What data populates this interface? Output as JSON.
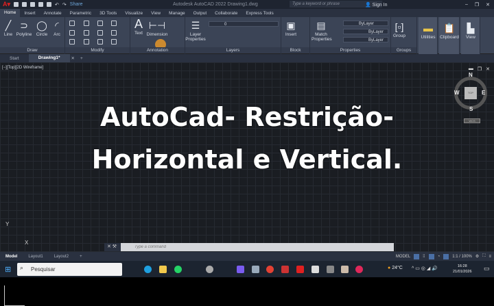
{
  "title_bar": {
    "app_title": "Autodesk AutoCAD 2022   Drawing1.dwg",
    "share": "Share",
    "search_placeholder": "Type a keyword or phrase",
    "sign_in": "Sign In"
  },
  "ribbon_tabs": [
    "Home",
    "Insert",
    "Annotate",
    "Parametric",
    "3D Tools",
    "Visualize",
    "View",
    "Manage",
    "Output",
    "Collaborate",
    "Express Tools"
  ],
  "draw_tools": [
    "Line",
    "Polyline",
    "Circle",
    "Arc"
  ],
  "panels": {
    "draw": "Draw",
    "modify": "Modify",
    "annotation": "Annotation",
    "layers": "Layers",
    "block": "Block",
    "properties": "Properties",
    "groups": "Groups"
  },
  "annotation_tools": [
    "Text",
    "Dimension"
  ],
  "layer_tools": {
    "layer_properties": "Layer Properties",
    "current_layer": "0"
  },
  "block_tools": {
    "insert": "Insert"
  },
  "properties_tools": {
    "match": "Match Properties",
    "color": "ByLayer",
    "linetype": "ByLayer",
    "lineweight": "ByLayer"
  },
  "groups_tools": {
    "group": "Group"
  },
  "big_buttons": [
    "Utilities",
    "Clipboard",
    "View"
  ],
  "file_tabs": [
    "Start",
    "Drawing1*"
  ],
  "viewport": {
    "label": "[−][Top][2D Wireframe]",
    "headline_1": "AutoCad- Restrição-",
    "headline_2": "Horizontal e Vertical.",
    "compass": {
      "n": "N",
      "s": "S",
      "e": "E",
      "w": "W",
      "top": "TOP",
      "wcs": "WCS"
    },
    "ucs_y": "Y",
    "ucs_x": "X"
  },
  "command_line": {
    "placeholder": "Type a command"
  },
  "layout_tabs": [
    "Model",
    "Layout1",
    "Layout2"
  ],
  "status_bar": {
    "model": "MODEL",
    "scale": "1:1 / 100%"
  },
  "taskbar": {
    "search": "Pesquisar",
    "weather": "24°C",
    "time": "16:28",
    "date": "21/01/2026"
  }
}
